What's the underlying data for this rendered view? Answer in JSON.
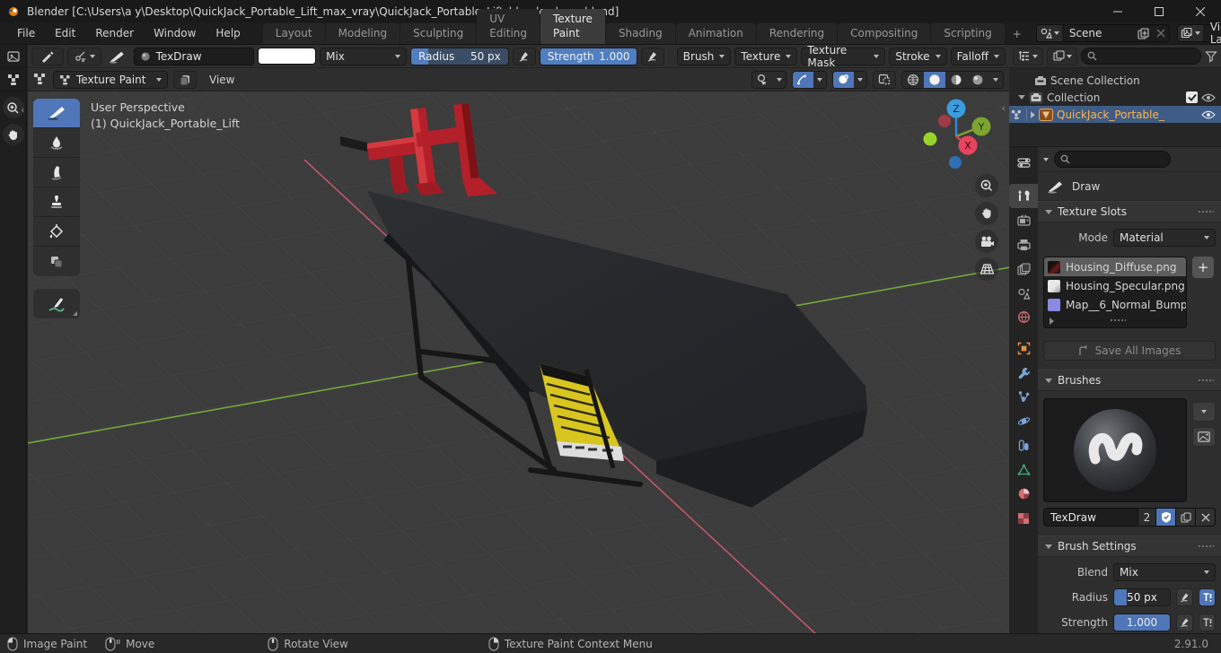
{
  "window": {
    "title": "Blender [C:\\Users\\a y\\Desktop\\QuickJack_Portable_Lift_max_vray\\QuickJack_Portable_Lift_blender_base.blend]"
  },
  "menus": {
    "file": "File",
    "edit": "Edit",
    "render": "Render",
    "window": "Window",
    "help": "Help"
  },
  "workspaces": {
    "items": [
      "Layout",
      "Modeling",
      "Sculpting",
      "UV Editing",
      "Texture Paint",
      "Shading",
      "Animation",
      "Rendering",
      "Compositing",
      "Scripting"
    ],
    "active": "Texture Paint",
    "add": "+"
  },
  "id_selectors": {
    "scene": "Scene",
    "view_layer": "View Layer"
  },
  "tool_settings": {
    "brush_name": "TexDraw",
    "blend": "Mix",
    "radius_label": "Radius",
    "radius_value": "50 px",
    "strength_label": "Strength",
    "strength_value": "1.000",
    "popovers": [
      "Brush",
      "Texture",
      "Texture Mask",
      "Stroke",
      "Falloff"
    ]
  },
  "viewport_header": {
    "mode": "Texture Paint",
    "view_menu": "View"
  },
  "viewport": {
    "perspective_label": "User Perspective",
    "object_info": "(1) QuickJack_Portable_Lift",
    "axis": {
      "x": "X",
      "y": "Y",
      "z": "Z"
    }
  },
  "outliner": {
    "scene_collection": "Scene Collection",
    "collection": "Collection",
    "object_name": "QuickJack_Portable_"
  },
  "properties": {
    "active_tool": "Draw",
    "texture_slots": {
      "title": "Texture Slots",
      "mode_label": "Mode",
      "mode_value": "Material",
      "slots": [
        "Housing_Diffuse.png",
        "Housing_Specular.png",
        "Map__6_Normal_Bump...."
      ],
      "add": "+",
      "save_all": "Save All Images"
    },
    "brushes": {
      "title": "Brushes",
      "name": "TexDraw",
      "users": "2"
    },
    "brush_settings": {
      "title": "Brush Settings",
      "blend_label": "Blend",
      "blend_value": "Mix",
      "radius_label": "Radius",
      "radius_value": "50 px",
      "strength_label": "Strength",
      "strength_value": "1.000"
    }
  },
  "status": {
    "image_paint": "Image Paint",
    "move": "Move",
    "rotate_view": "Rotate View",
    "context_menu": "Texture Paint Context Menu",
    "version": "2.91.0"
  },
  "colors": {
    "accent_blue": "#4f76b8",
    "selection_blue": "#3e5c85",
    "object_orange": "#ffb351",
    "axis_green": "#74a83d",
    "axis_red": "#c3566a",
    "model_red": "#b3202a",
    "label_yellow": "#d8c520"
  }
}
